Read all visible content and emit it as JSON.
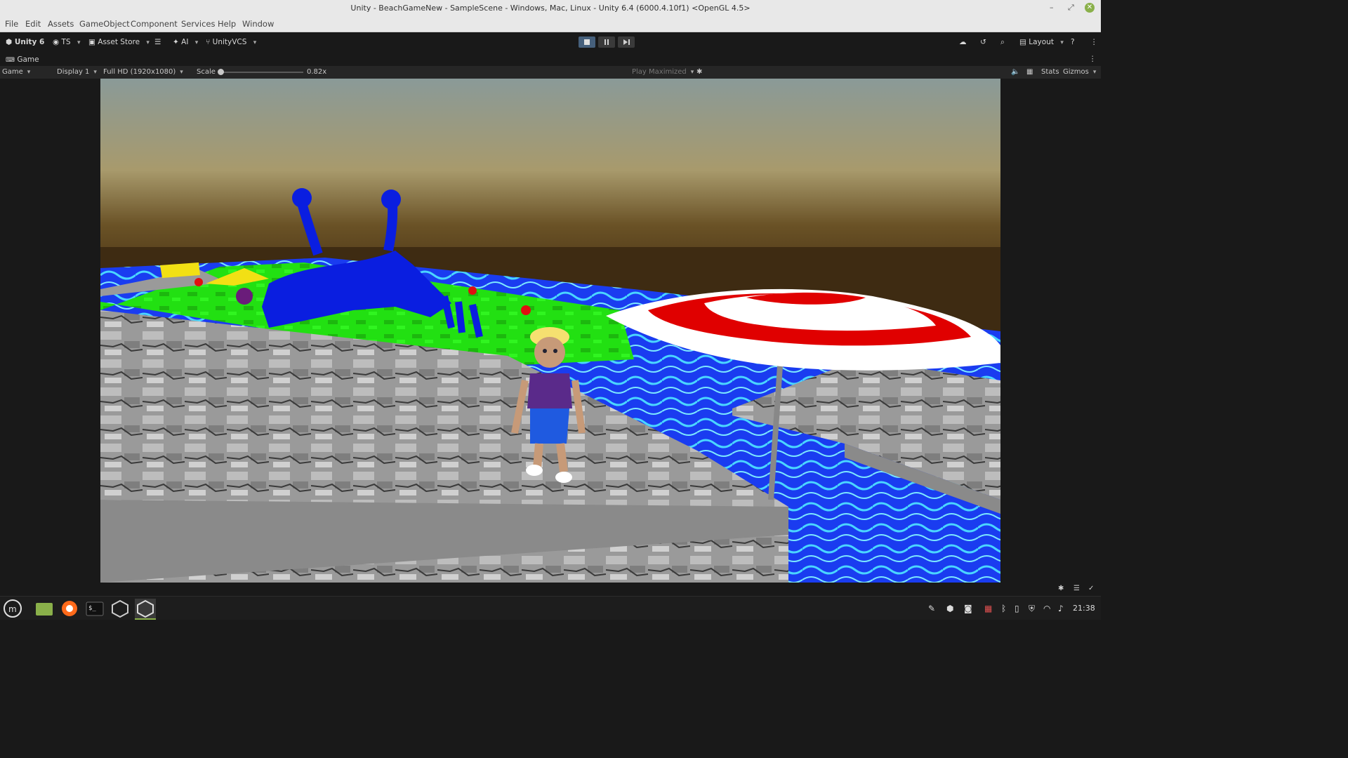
{
  "window": {
    "title": "Unity - BeachGameNew - SampleScene - Windows, Mac, Linux - Unity 6.4 (6000.4.10f1) <OpenGL 4.5>",
    "controls": [
      "–",
      "⤢",
      "✕"
    ]
  },
  "menu": [
    "File",
    "Edit",
    "Assets",
    "GameObject",
    "Component",
    "Services",
    "Help",
    "Window"
  ],
  "toolbar": {
    "unity_label": "Unity 6",
    "account_label": "TS",
    "asset_store_label": "Asset Store",
    "ai_label": "AI",
    "vcs_label": "UnityVCS",
    "layout_label": "Layout"
  },
  "tab": {
    "label": "Game"
  },
  "gamebar": {
    "view_select": "Game",
    "display_select": "Display 1",
    "resolution_select": "Full HD (1920x1080)",
    "scale_label": "Scale",
    "scale_value": "0.82x",
    "play_mode_select": "Play Maximized",
    "stats_label": "Stats",
    "gizmos_label": "Gizmos"
  },
  "colors": {
    "editor_bg": "#191919",
    "toolbar_bg": "#262626",
    "titlebar_bg": "#e8e8e8",
    "play_active": "#46607c",
    "mint_green": "#8ab04a"
  },
  "icons": [
    "unity-logo-icon",
    "account-icon",
    "cart-icon",
    "ai-sparkle-icon",
    "branch-icon",
    "cloud-icon",
    "history-icon",
    "search-icon",
    "layout-icon",
    "help-icon",
    "more-icon",
    "gamepad-icon",
    "audio-icon",
    "keyboard-icon",
    "bug-icon"
  ],
  "taskbar": {
    "clock": "21:38",
    "apps": [
      "mint-menu-icon",
      "files-icon",
      "firefox-icon",
      "terminal-icon",
      "unity-hub-icon",
      "unity-editor-icon"
    ]
  }
}
